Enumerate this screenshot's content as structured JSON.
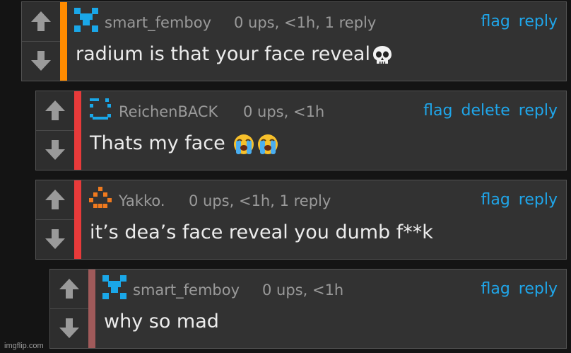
{
  "comments": [
    {
      "username": "smart_femboy",
      "meta": "0 ups, <1h, 1 reply",
      "text": "radium is that your face reveal",
      "emoji": "skull-emoji",
      "stripe_color": "#ff8b00",
      "actions": [
        "flag",
        "reply"
      ]
    },
    {
      "username": "ReichenBACK",
      "meta": "0 ups, <1h",
      "text": "Thats my face ",
      "emoji": "loudly-crying-face-emoji x2",
      "stripe_color": "#e83a3a",
      "actions": [
        "flag",
        "delete",
        "reply"
      ]
    },
    {
      "username": "Yakko.",
      "meta": "0 ups, <1h, 1 reply",
      "text": "it’s dea’s face reveal you dumb f**k",
      "stripe_color": "#e83a3a",
      "actions": [
        "flag",
        "reply"
      ]
    },
    {
      "username": "smart_femboy",
      "meta": "0 ups, <1h",
      "text": "why so mad",
      "stripe_color": "#a05a5a",
      "actions": [
        "flag",
        "reply"
      ]
    }
  ],
  "watermark": "imgflip.com",
  "colors": {
    "link": "#1fa6ea",
    "background": "#141414",
    "card": "#323232"
  }
}
